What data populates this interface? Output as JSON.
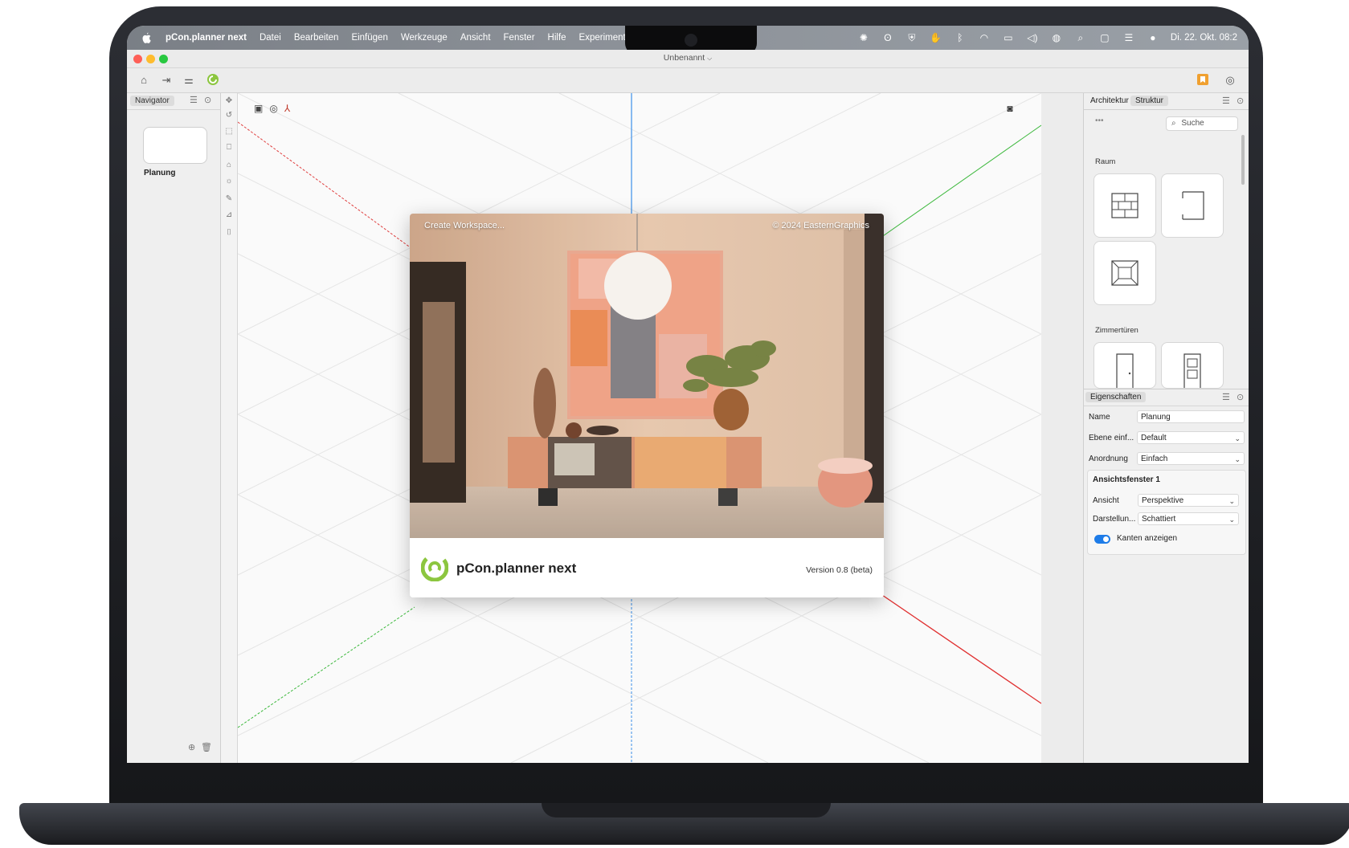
{
  "menubar": {
    "app_name": "pCon.planner next",
    "items": [
      "Datei",
      "Bearbeiten",
      "Einfügen",
      "Werkzeuge",
      "Ansicht",
      "Fenster",
      "Hilfe",
      "Experimentell"
    ],
    "clock": "Di. 22. Okt. 08:2"
  },
  "window": {
    "title": "Unbenannt"
  },
  "navigator": {
    "tab_label": "Navigator",
    "planning_label": "Planung"
  },
  "splash": {
    "create_workspace": "Create Workspace...",
    "copyright": "© 2024 EasternGraphics",
    "product_name": "pCon.planner next",
    "version": "Version 0.8 (beta)"
  },
  "catalog": {
    "tabs": [
      "Architektur",
      "Struktur"
    ],
    "search_placeholder": "Suche",
    "section_room": "Raum",
    "section_doors": "Zimmertüren"
  },
  "properties": {
    "title": "Eigenschaften",
    "name_label": "Name",
    "name_value": "Planung",
    "layer_label": "Ebene einf...",
    "layer_value": "Default",
    "arrangement_label": "Anordnung",
    "arrangement_value": "Einfach",
    "viewport_section": "Ansichtsfenster 1",
    "view_label": "Ansicht",
    "view_value": "Perspektive",
    "display_label": "Darstellun...",
    "display_value": "Schattiert",
    "edges_label": "Kanten anzeigen",
    "edges_on": true
  },
  "colors": {
    "brand_green": "#8cc63f",
    "accent_orange": "#f0a030",
    "toggle_blue": "#1e7ce8"
  }
}
